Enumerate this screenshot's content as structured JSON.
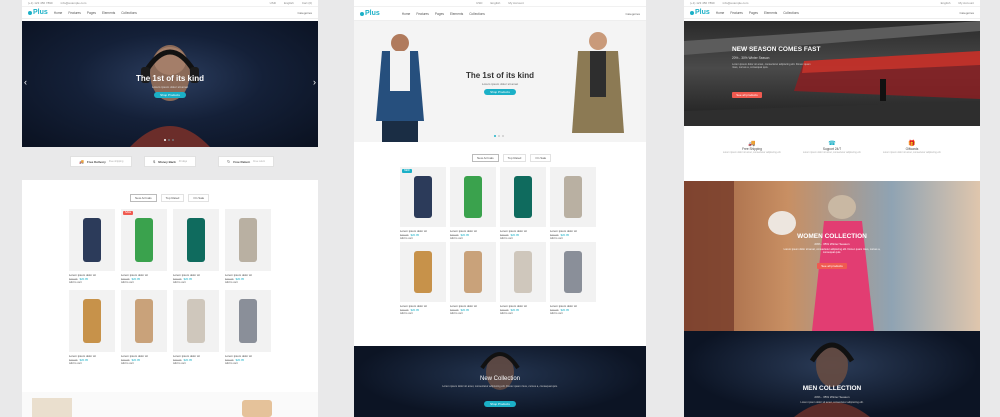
{
  "brand": {
    "logo": "Plus",
    "accent": "#1bb0c7",
    "sale": "#f05a50",
    "new": "#1bb0c7"
  },
  "topbar": {
    "phone": "(+1) 123 456 7890",
    "email": "info@example.com",
    "currency": "USD",
    "lang": "English",
    "account": "My Account",
    "cart": "Cart (0)"
  },
  "nav": [
    "Home",
    "Features",
    "Pages",
    "Elements",
    "Collections"
  ],
  "nav_right": "Categories",
  "panel1": {
    "hero": {
      "title": "The 1st of its kind",
      "subtitle": "Lorem ipsum dolor sit amet",
      "cta": "Shop Products"
    },
    "strip": [
      {
        "icon": "truck-icon",
        "glyph": "🚚",
        "label": "Free Delivery",
        "note": "Free shipping"
      },
      {
        "icon": "money-icon",
        "glyph": "$",
        "label": "Money Back",
        "note": "30 days"
      },
      {
        "icon": "return-icon",
        "glyph": "↻",
        "label": "Free Return",
        "note": "Free return"
      }
    ],
    "tabs": [
      "New Arrivals",
      "Top Rated",
      "On Sale"
    ],
    "products": [
      {
        "name": "Lorem ipsum dolor sit",
        "old": "$39.95",
        "price": "$20.95",
        "add": "Add to cart",
        "badge": "",
        "swatch": "#2c3b5a"
      },
      {
        "name": "Lorem ipsum dolor sit",
        "old": "$39.95",
        "price": "$20.95",
        "add": "Add to cart",
        "badge": "SALE",
        "swatch": "#3aa24d"
      },
      {
        "name": "Lorem ipsum dolor sit",
        "old": "$39.95",
        "price": "$20.95",
        "add": "Add to cart",
        "badge": "",
        "swatch": "#0f6b5e"
      },
      {
        "name": "Lorem ipsum dolor sit",
        "old": "$39.95",
        "price": "$20.95",
        "add": "Add to cart",
        "badge": "",
        "swatch": "#b9b0a2"
      },
      {
        "name": "Lorem ipsum dolor sit",
        "old": "$39.95",
        "price": "$20.95",
        "add": "Add to cart",
        "badge": "",
        "swatch": "#c7924a"
      },
      {
        "name": "Lorem ipsum dolor sit",
        "old": "$39.95",
        "price": "$20.95",
        "add": "Add to cart",
        "badge": "",
        "swatch": "#c9a27a"
      },
      {
        "name": "Lorem ipsum dolor sit",
        "old": "$39.95",
        "price": "$20.95",
        "add": "Add to cart",
        "badge": "",
        "swatch": "#cfc7bc"
      },
      {
        "name": "Lorem ipsum dolor sit",
        "old": "$39.95",
        "price": "$20.95",
        "add": "Add to cart",
        "badge": "",
        "swatch": "#8a8f99"
      }
    ]
  },
  "panel2": {
    "hero": {
      "title": "The 1st of its kind",
      "subtitle": "Lorem ipsum dolor sit amet",
      "cta": "Shop Products"
    },
    "tabs": [
      "New Arrivals",
      "Top Rated",
      "On Sale"
    ],
    "products": [
      {
        "name": "Lorem ipsum dolor sit",
        "old": "$39.95",
        "price": "$20.95",
        "add": "Add to cart",
        "badge": "NEW",
        "swatch": "#2c3b5a"
      },
      {
        "name": "Lorem ipsum dolor sit",
        "old": "$39.95",
        "price": "$20.95",
        "add": "Add to cart",
        "badge": "",
        "swatch": "#3aa24d"
      },
      {
        "name": "Lorem ipsum dolor sit",
        "old": "$39.95",
        "price": "$20.95",
        "add": "Add to cart",
        "badge": "",
        "swatch": "#0f6b5e"
      },
      {
        "name": "Lorem ipsum dolor sit",
        "old": "$39.95",
        "price": "$20.95",
        "add": "Add to cart",
        "badge": "",
        "swatch": "#b9b0a2"
      },
      {
        "name": "Lorem ipsum dolor sit",
        "old": "$39.95",
        "price": "$20.95",
        "add": "Add to cart",
        "badge": "",
        "swatch": "#c7924a"
      },
      {
        "name": "Lorem ipsum dolor sit",
        "old": "$39.95",
        "price": "$20.95",
        "add": "Add to cart",
        "badge": "",
        "swatch": "#c9a27a"
      },
      {
        "name": "Lorem ipsum dolor sit",
        "old": "$39.95",
        "price": "$20.95",
        "add": "Add to cart",
        "badge": "",
        "swatch": "#cfc7bc"
      },
      {
        "name": "Lorem ipsum dolor sit",
        "old": "$39.95",
        "price": "$20.95",
        "add": "Add to cart",
        "badge": "",
        "swatch": "#8a8f99"
      }
    ],
    "banner": {
      "title": "New Collection",
      "text": "Lorem ipsum dolor sit amet, consectetur adipiscing elit. Donec quam risus, cursus a, consequat quis.",
      "cta": "Shop Products"
    }
  },
  "panel3": {
    "hero": {
      "title": "NEW SEASON COMES FAST",
      "subtitle": "20% - 30% Winter Season",
      "text": "Lorem ipsum dolor sit amet, consectetur adipiscing elit. Donec quam risus, cursus a, consequat quis.",
      "cta": "See all products"
    },
    "features": [
      {
        "icon": "truck-icon",
        "glyph": "🚚",
        "title": "Free Shipping",
        "text": "Lorem ipsum dolor sit amet, consectetur adipiscing elit."
      },
      {
        "icon": "support-icon",
        "glyph": "☎",
        "title": "Support 24/7",
        "text": "Lorem ipsum dolor sit amet, consectetur adipiscing elit."
      },
      {
        "icon": "gift-icon",
        "glyph": "🎁",
        "title": "Giftcards",
        "text": "Lorem ipsum dolor sit amet, consectetur adipiscing elit."
      }
    ],
    "women": {
      "title": "WOMEN COLLECTION",
      "subtitle": "20% - 35% Winter Season",
      "text": "Lorem ipsum dolor sit amet, consectetur adipiscing elit. Donec quam risus, cursus a, consequat quis.",
      "cta": "See all products"
    },
    "men": {
      "title": "MEN COLLECTION",
      "subtitle": "20% - 35% Winter Season",
      "text": "Lorem ipsum dolor sit amet, consectetur adipiscing elit."
    }
  }
}
